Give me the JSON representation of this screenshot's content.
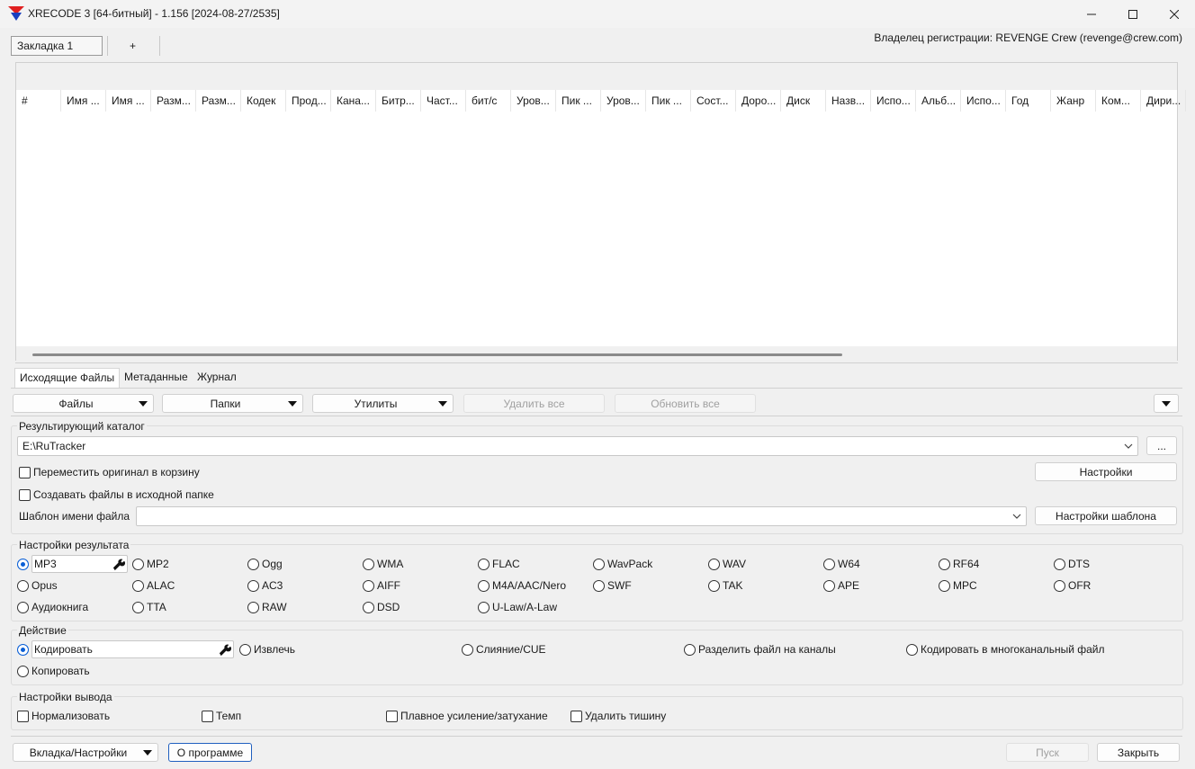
{
  "window": {
    "title": "XRECODE 3 [64-битный] - 1.156 [2024-08-27/2535]",
    "minimize": "–",
    "maximize": "☐",
    "close": "✕"
  },
  "doc_tabs": [
    {
      "label": "Закладка 1"
    },
    {
      "label": "+"
    }
  ],
  "owner": "Владелец регистрации: REVENGE Crew (revenge@crew.com)",
  "grid": {
    "columns": [
      "#",
      "Имя ...",
      "Имя ...",
      "Разм...",
      "Разм...",
      "Кодек",
      "Прод...",
      "Кана...",
      "Битр...",
      "Част...",
      "бит/с",
      "Уров...",
      "Пик ...",
      "Уров...",
      "Пик ...",
      "Сост...",
      "Доро...",
      "Диск",
      "Назв...",
      "Испо...",
      "Альб...",
      "Испо...",
      "Год",
      "Жанр",
      "Ком...",
      "Дири..."
    ]
  },
  "subtabs": [
    {
      "label": "Исходящие Файлы"
    },
    {
      "label": "Метаданные"
    },
    {
      "label": "Журнал"
    }
  ],
  "toolbar": {
    "files": "Файлы",
    "folders": "Папки",
    "utilities": "Утилиты",
    "remove_all": "Удалить все",
    "refresh_all": "Обновить все"
  },
  "output_dir": {
    "title": "Результирующий каталог",
    "path": "E:\\RuTracker",
    "browse": "...",
    "move_to_trash": "Переместить оригинал в корзину",
    "settings": "Настройки",
    "create_in_source": "Создавать файлы в исходной папке",
    "template_label": "Шаблон имени файла",
    "template_value": "",
    "template_settings": "Настройки шаблона"
  },
  "result": {
    "title": "Настройки результата",
    "selected": "MP3",
    "formats_row1": [
      "MP2",
      "Ogg",
      "WMA",
      "FLAC",
      "WavPack",
      "WAV",
      "W64",
      "RF64",
      "DTS"
    ],
    "formats_row2": [
      "Opus",
      "ALAC",
      "AC3",
      "AIFF",
      "M4A/AAC/Nero",
      "SWF",
      "TAK",
      "APE",
      "MPC",
      "OFR"
    ],
    "formats_row3": [
      "Аудиокнига",
      "TTA",
      "RAW",
      "DSD",
      "U-Law/A-Law"
    ]
  },
  "action": {
    "title": "Действие",
    "selected": "Кодировать",
    "options": [
      "Извлечь",
      "Слияние/CUE",
      "Разделить файл на каналы",
      "Кодировать в многоканальный файл"
    ],
    "copy": "Копировать"
  },
  "output_settings": {
    "title": "Настройки вывода",
    "options": [
      "Нормализовать",
      "Темп",
      "Плавное усиление/затухание",
      "Удалить тишину"
    ]
  },
  "footer": {
    "tab_settings": "Вкладка/Настройки",
    "about": "О программе",
    "start": "Пуск",
    "close": "Закрыть"
  },
  "colors": {
    "accent": "#0a5fd6",
    "app_icon_red": "#e02020",
    "app_icon_blue": "#1a3fbf"
  }
}
